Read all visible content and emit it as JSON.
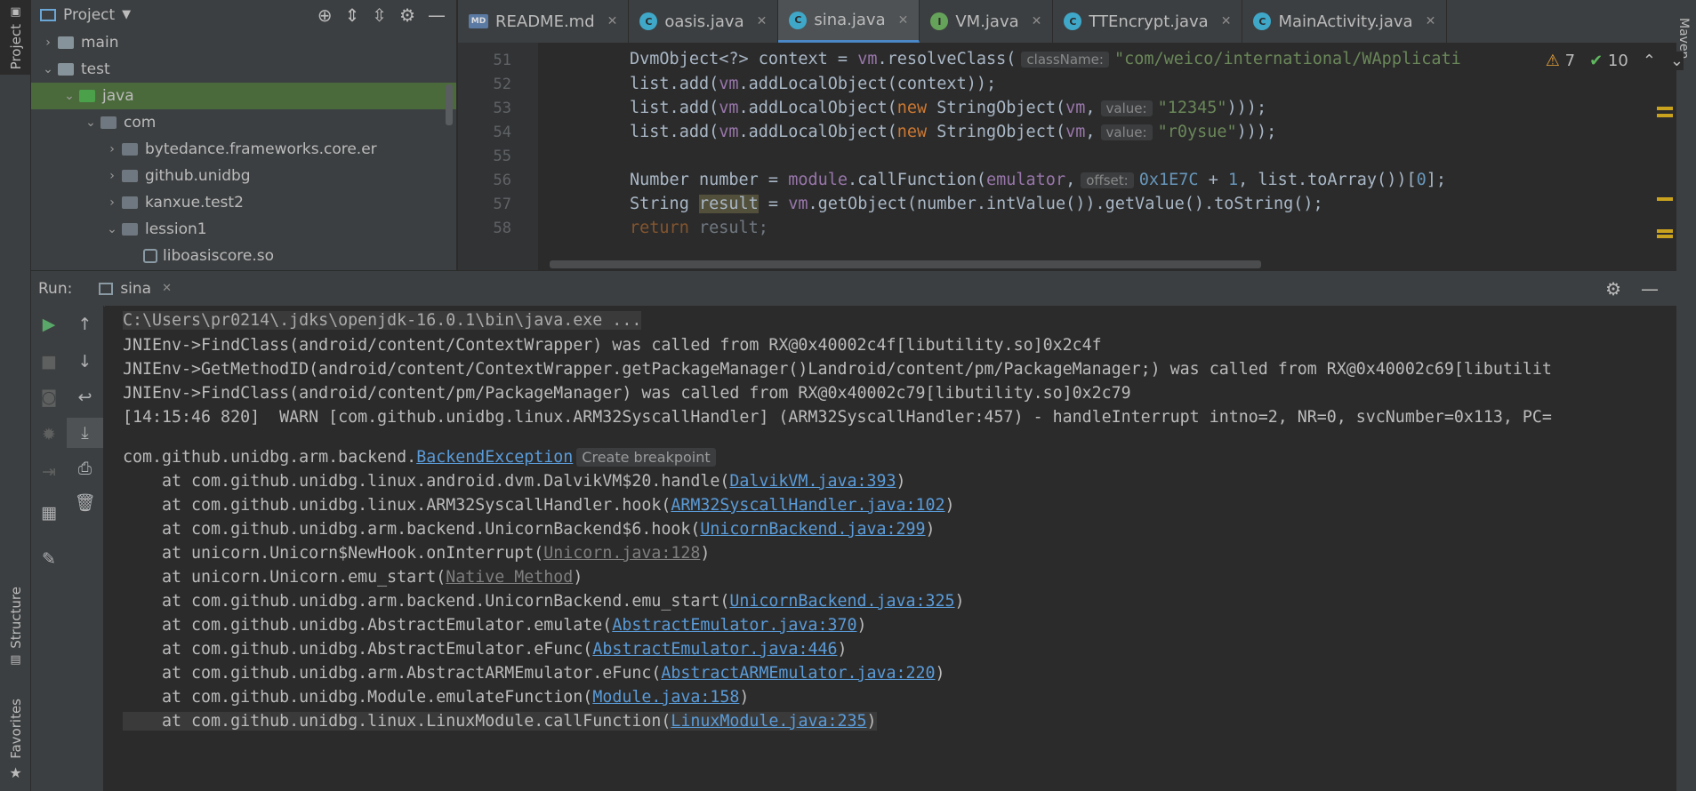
{
  "left_strip": {
    "project": "Project",
    "structure": "Structure",
    "favorites": "Favorites"
  },
  "right_strip": {
    "maven": "Maven"
  },
  "project_panel": {
    "title": "Project",
    "tree": [
      {
        "label": "main",
        "indent": 2,
        "arrow": "›",
        "icon": "folder"
      },
      {
        "label": "test",
        "indent": 2,
        "arrow": "⌄",
        "icon": "folder"
      },
      {
        "label": "java",
        "indent": 3,
        "arrow": "⌄",
        "icon": "folder-green"
      },
      {
        "label": "com",
        "indent": 4,
        "arrow": "⌄",
        "icon": "package"
      },
      {
        "label": "bytedance.frameworks.core.er",
        "indent": 5,
        "arrow": "›",
        "icon": "package"
      },
      {
        "label": "github.unidbg",
        "indent": 5,
        "arrow": "›",
        "icon": "package"
      },
      {
        "label": "kanxue.test2",
        "indent": 5,
        "arrow": "›",
        "icon": "package"
      },
      {
        "label": "lession1",
        "indent": 5,
        "arrow": "⌄",
        "icon": "package"
      },
      {
        "label": "liboasiscore.so",
        "indent": 6,
        "arrow": "",
        "icon": "so-file"
      }
    ]
  },
  "editor_tabs": [
    {
      "label": "README.md",
      "icon": "markdown-icon",
      "active": false
    },
    {
      "label": "oasis.java",
      "icon": "class-icon",
      "active": false
    },
    {
      "label": "sina.java",
      "icon": "class-icon",
      "active": true
    },
    {
      "label": "VM.java",
      "icon": "interface-icon",
      "active": false
    },
    {
      "label": "TTEncrypt.java",
      "icon": "class-icon",
      "active": false
    },
    {
      "label": "MainActivity.java",
      "icon": "class-icon",
      "active": false
    }
  ],
  "editor": {
    "line_numbers": [
      "51",
      "52",
      "53",
      "54",
      "55",
      "56",
      "57",
      "58"
    ],
    "line51": {
      "a": "DvmObject<?> context = ",
      "vm": "vm",
      "b": ".resolveClass(",
      "hint": "className:",
      "str": "\"com/weico/international/WApplicati"
    },
    "line52": {
      "a": "list.add(",
      "vm": "vm",
      "b": ".addLocalObject(context));"
    },
    "line53": {
      "a": "list.add(",
      "vm": "vm",
      "b": ".addLocalObject(",
      "kw": "new",
      "c": " StringObject(",
      "vm2": "vm",
      "d": ",",
      "hint": "value:",
      "str": "\"12345\"",
      "e": ")));"
    },
    "line54": {
      "a": "list.add(",
      "vm": "vm",
      "b": ".addLocalObject(",
      "kw": "new",
      "c": " StringObject(",
      "vm2": "vm",
      "d": ",",
      "hint": "value:",
      "str": "\"r0ysue\"",
      "e": ")));"
    },
    "line56": {
      "a": "Number number = ",
      "f1": "module",
      "b": ".callFunction(",
      "f2": "emulator",
      "d": ",",
      "hint": "offset:",
      "n1": "0x1E7C",
      "c": " + ",
      "n2": "1",
      "e": ", list.toArray())[",
      "n3": "0",
      "g": "];"
    },
    "line57": {
      "a": "String ",
      "res": "result",
      "b": " = ",
      "vm": "vm",
      "c": ".getObject(number.intValue()).getValue().toString();"
    },
    "line58": {
      "kw": "return",
      "a": " result;"
    },
    "inspections": {
      "warnings": "7",
      "ok": "10"
    }
  },
  "run": {
    "label": "Run:",
    "tab": "sina",
    "cmd": "C:\\Users\\pr0214\\.jdks\\openjdk-16.0.1\\bin\\java.exe ...",
    "lines": [
      "JNIEnv->FindClass(android/content/ContextWrapper) was called from RX@0x40002c4f[libutility.so]0x2c4f",
      "JNIEnv->GetMethodID(android/content/ContextWrapper.getPackageManager()Landroid/content/pm/PackageManager;) was called from RX@0x40002c69[libutilit",
      "JNIEnv->FindClass(android/content/pm/PackageManager) was called from RX@0x40002c79[libutility.so]0x2c79",
      "[14:15:46 820]  WARN [com.github.unidbg.linux.ARM32SyscallHandler] (ARM32SyscallHandler:457) - handleInterrupt intno=2, NR=0, svcNumber=0x113, PC="
    ],
    "exception": {
      "prefix": "com.github.unidbg.arm.backend.",
      "link": "BackendException",
      "hint": "Create breakpoint"
    },
    "stack": [
      {
        "pre": "    at com.github.unidbg.linux.android.dvm.DalvikVM$20.handle(",
        "link": "DalvikVM.java:393",
        "gray": false
      },
      {
        "pre": "    at com.github.unidbg.linux.ARM32SyscallHandler.hook(",
        "link": "ARM32SyscallHandler.java:102",
        "gray": false
      },
      {
        "pre": "    at com.github.unidbg.arm.backend.UnicornBackend$6.hook(",
        "link": "UnicornBackend.java:299",
        "gray": false
      },
      {
        "pre": "    at unicorn.Unicorn$NewHook.onInterrupt(",
        "link": "Unicorn.java:128",
        "gray": true
      },
      {
        "pre": "    at unicorn.Unicorn.emu_start(",
        "link": "Native Method",
        "gray": true
      },
      {
        "pre": "    at com.github.unidbg.arm.backend.UnicornBackend.emu_start(",
        "link": "UnicornBackend.java:325",
        "gray": false
      },
      {
        "pre": "    at com.github.unidbg.AbstractEmulator.emulate(",
        "link": "AbstractEmulator.java:370",
        "gray": false
      },
      {
        "pre": "    at com.github.unidbg.AbstractEmulator.eFunc(",
        "link": "AbstractEmulator.java:446",
        "gray": false
      },
      {
        "pre": "    at com.github.unidbg.arm.AbstractARMEmulator.eFunc(",
        "link": "AbstractARMEmulator.java:220",
        "gray": false
      },
      {
        "pre": "    at com.github.unidbg.Module.emulateFunction(",
        "link": "Module.java:158",
        "gray": false
      },
      {
        "pre": "    at com.github.unidbg.linux.LinuxModule.callFunction(",
        "link": "LinuxModule.java:235",
        "gray": false
      }
    ]
  }
}
